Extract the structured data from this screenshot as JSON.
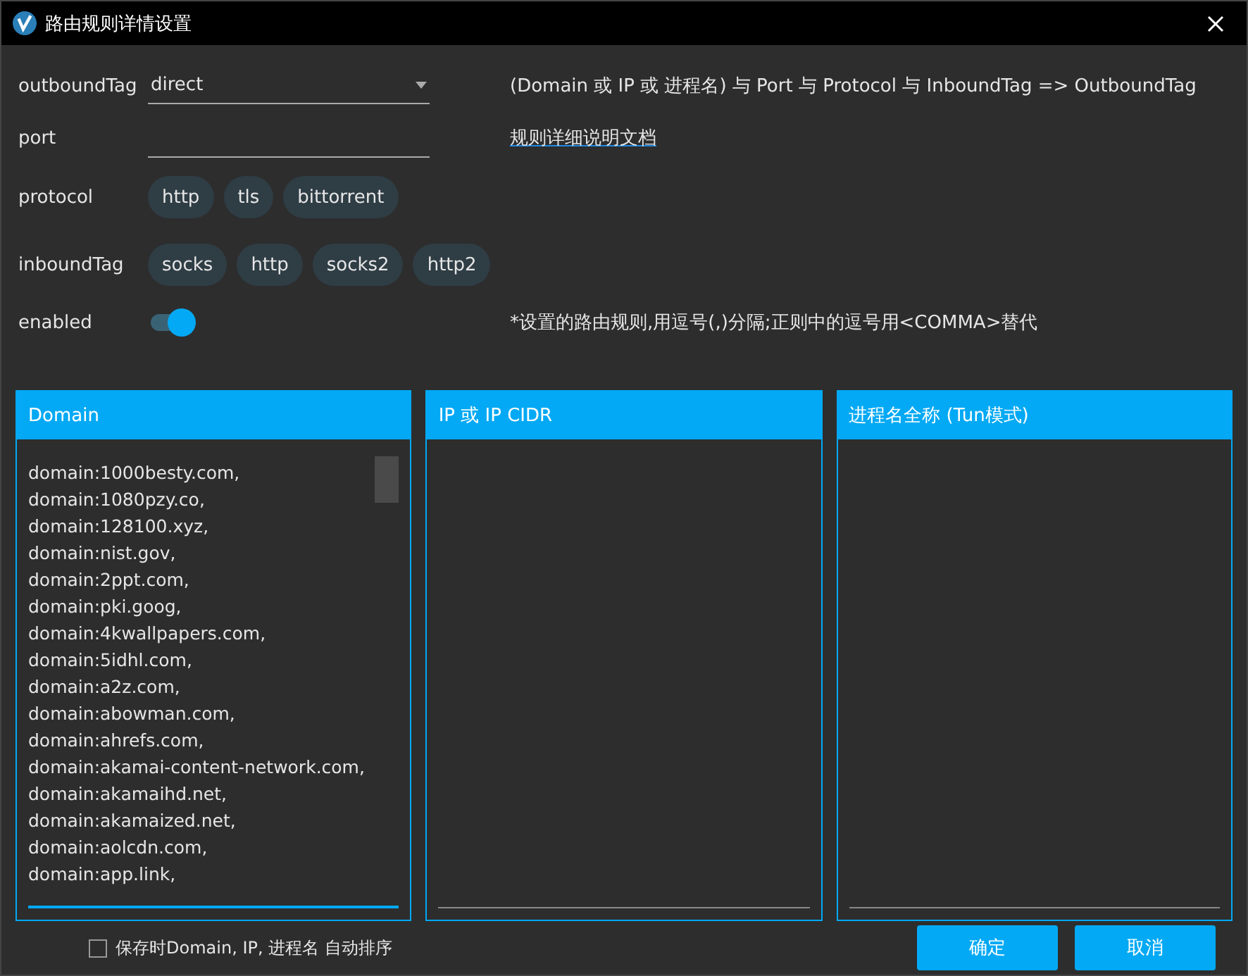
{
  "window": {
    "title": "路由规则详情设置"
  },
  "outbound_tag": {
    "label": "outboundTag",
    "value": "direct"
  },
  "port": {
    "label": "port"
  },
  "protocol": {
    "label": "protocol",
    "options": [
      {
        "label": "http",
        "selected": false
      },
      {
        "label": "tls",
        "selected": false
      },
      {
        "label": "bittorrent",
        "selected": false
      }
    ]
  },
  "inbound_tag": {
    "label": "inboundTag",
    "options": [
      {
        "label": "socks",
        "selected": false
      },
      {
        "label": "http",
        "selected": false
      },
      {
        "label": "socks2",
        "selected": false
      },
      {
        "label": "http2",
        "selected": false
      }
    ]
  },
  "enabled": {
    "label": "enabled",
    "on": true
  },
  "formula": "(Domain 或 IP 或 进程名) 与 Port 与 Protocol 与 InboundTag => OutboundTag",
  "doc_link": "规则详细说明文档",
  "hint": "*设置的路由规则,用逗号(,)分隔;正则中的逗号用<COMMA>替代",
  "panels": [
    {
      "title": "Domain",
      "lines": [
        "domain:1000besty.com,",
        "domain:1080pzy.co,",
        "domain:128100.xyz,",
        "domain:nist.gov,",
        "domain:2ppt.com,",
        "domain:pki.goog,",
        "domain:4kwallpapers.com,",
        "domain:5idhl.com,",
        "domain:a2z.com,",
        "domain:abowman.com,",
        "domain:ahrefs.com,",
        "domain:akamai-content-network.com,",
        "domain:akamaihd.net,",
        "domain:akamaized.net,",
        "domain:aolcdn.com,",
        "domain:app.link,"
      ],
      "focused": true
    },
    {
      "title": "IP 或 IP CIDR",
      "focused": false
    },
    {
      "title": "进程名全称 (Tun模式)",
      "focused": false
    }
  ],
  "auto_sort": {
    "label": "保存时Domain, IP, 进程名 自动排序",
    "checked": false
  },
  "buttons": [
    "确定",
    "取消"
  ]
}
